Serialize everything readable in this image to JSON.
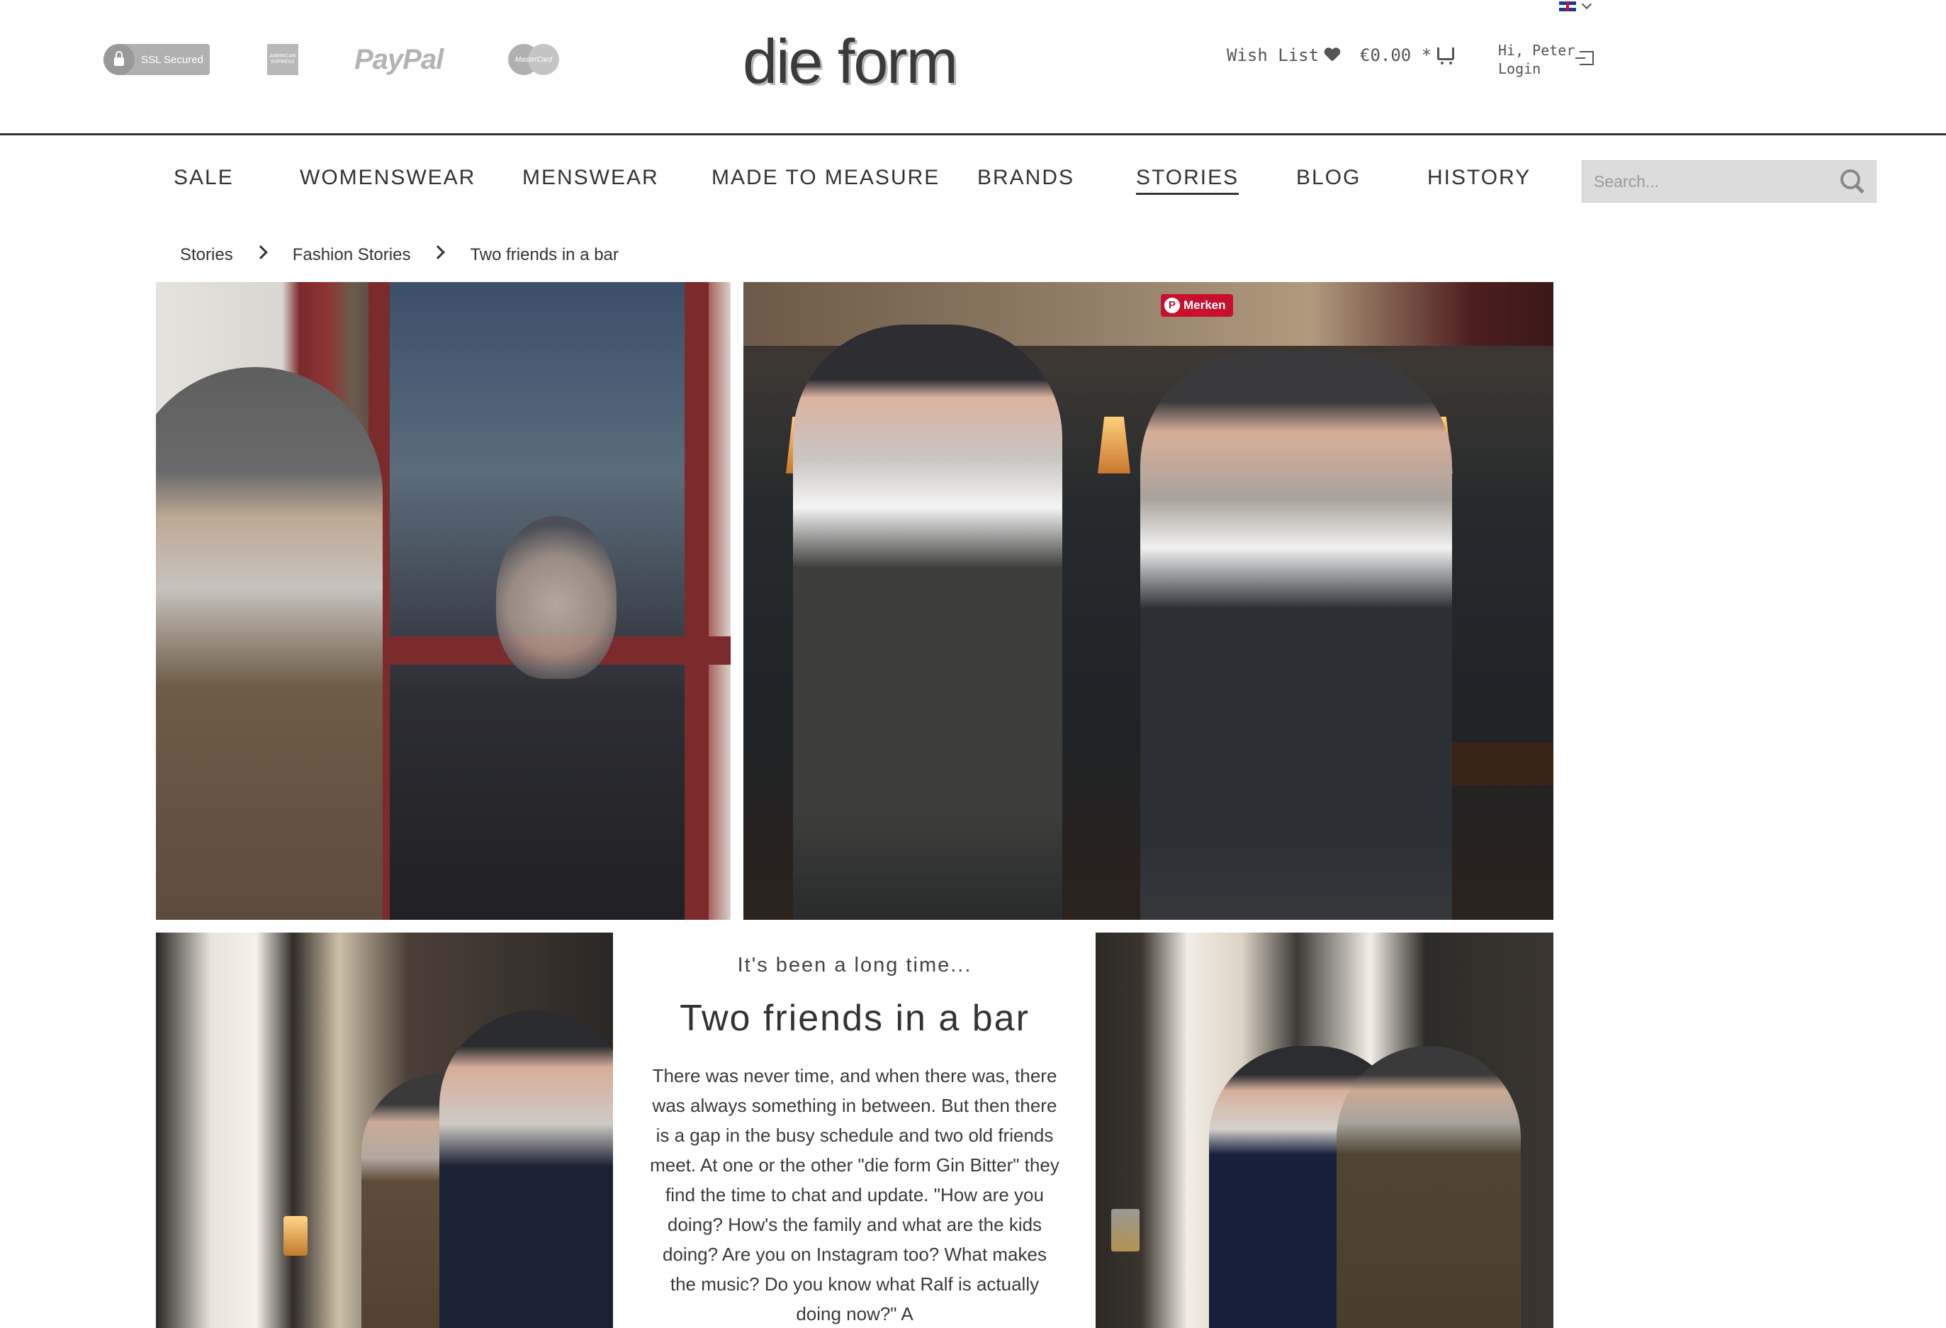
{
  "header": {
    "ssl_label": "SSL Secured",
    "amex_label": "AMERICAN EXPRESS",
    "paypal_label": "PayPal",
    "mastercard_label": "MasterCard",
    "logo": "die form",
    "wishlist_label": "Wish List",
    "cart_total": "€0.00 *",
    "greeting": "Hi, Peter",
    "login_label": "Login"
  },
  "nav": {
    "items": [
      {
        "label": "SALE"
      },
      {
        "label": "WOMENSWEAR"
      },
      {
        "label": "MENSWEAR"
      },
      {
        "label": "MADE TO MEASURE"
      },
      {
        "label": "BRANDS"
      },
      {
        "label": "STORIES",
        "active": true
      },
      {
        "label": "BLOG"
      },
      {
        "label": "HISTORY"
      }
    ],
    "search_placeholder": "Search..."
  },
  "breadcrumb": [
    "Stories",
    "Fashion Stories",
    "Two friends in a bar"
  ],
  "pinterest_label": "Merken",
  "story": {
    "kicker": "It's been a long time...",
    "title": "Two friends in a bar",
    "body": "There was never time, and when there was, there was always something in between. But then there is a gap in the busy schedule and two old friends meet. At one or the other \"die form Gin Bitter\" they find the time to chat and update. \"How are you doing?  How's the family and what are the kids doing? Are you on Instagram too? What makes the music? Do you know what Ralf is actually doing now?\"  A"
  },
  "colors": {
    "text": "#333333",
    "search_bg": "#dcdcdc",
    "pinterest": "#c8102e"
  }
}
